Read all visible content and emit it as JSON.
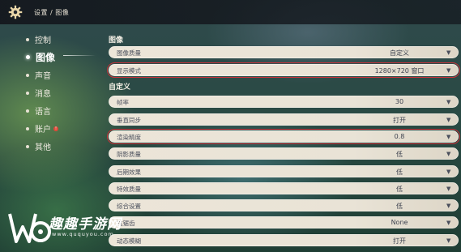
{
  "breadcrumb": "设置 / 图像",
  "sidebar": {
    "items": [
      {
        "label": "控制",
        "active": false
      },
      {
        "label": "图像",
        "active": true
      },
      {
        "label": "声音",
        "active": false
      },
      {
        "label": "消息",
        "active": false
      },
      {
        "label": "语言",
        "active": false
      },
      {
        "label": "账户",
        "active": false,
        "badge": "!"
      },
      {
        "label": "其他",
        "active": false
      }
    ]
  },
  "sections": {
    "image": "图像",
    "custom": "自定义"
  },
  "image_settings": [
    {
      "label": "图像质量",
      "value": "自定义"
    },
    {
      "label": "显示模式",
      "value": "1280×720 窗口",
      "highlighted": true
    }
  ],
  "custom_settings": [
    {
      "label": "帧率",
      "value": "30"
    },
    {
      "label": "垂直同步",
      "value": "打开"
    },
    {
      "label": "渲染精度",
      "value": "0.8",
      "highlighted": true
    },
    {
      "label": "阴影质量",
      "value": "低"
    },
    {
      "label": "后期效果",
      "value": "低"
    },
    {
      "label": "特效质量",
      "value": "低"
    },
    {
      "label": "综合设置",
      "value": "低"
    },
    {
      "label": "抗锯齿",
      "value": "None"
    },
    {
      "label": "动态模糊",
      "value": "打开"
    }
  ],
  "watermark": {
    "text": "趣趣手游网",
    "url": "www.ququyou.com"
  },
  "colors": {
    "row_bg": "#ece5d8",
    "highlight_border": "#c8333a",
    "text_dark": "#4a4f5c",
    "topbar_bg": "#14181e"
  },
  "icons": {
    "settings": "gear-icon",
    "dropdown": "caret-down-icon"
  }
}
